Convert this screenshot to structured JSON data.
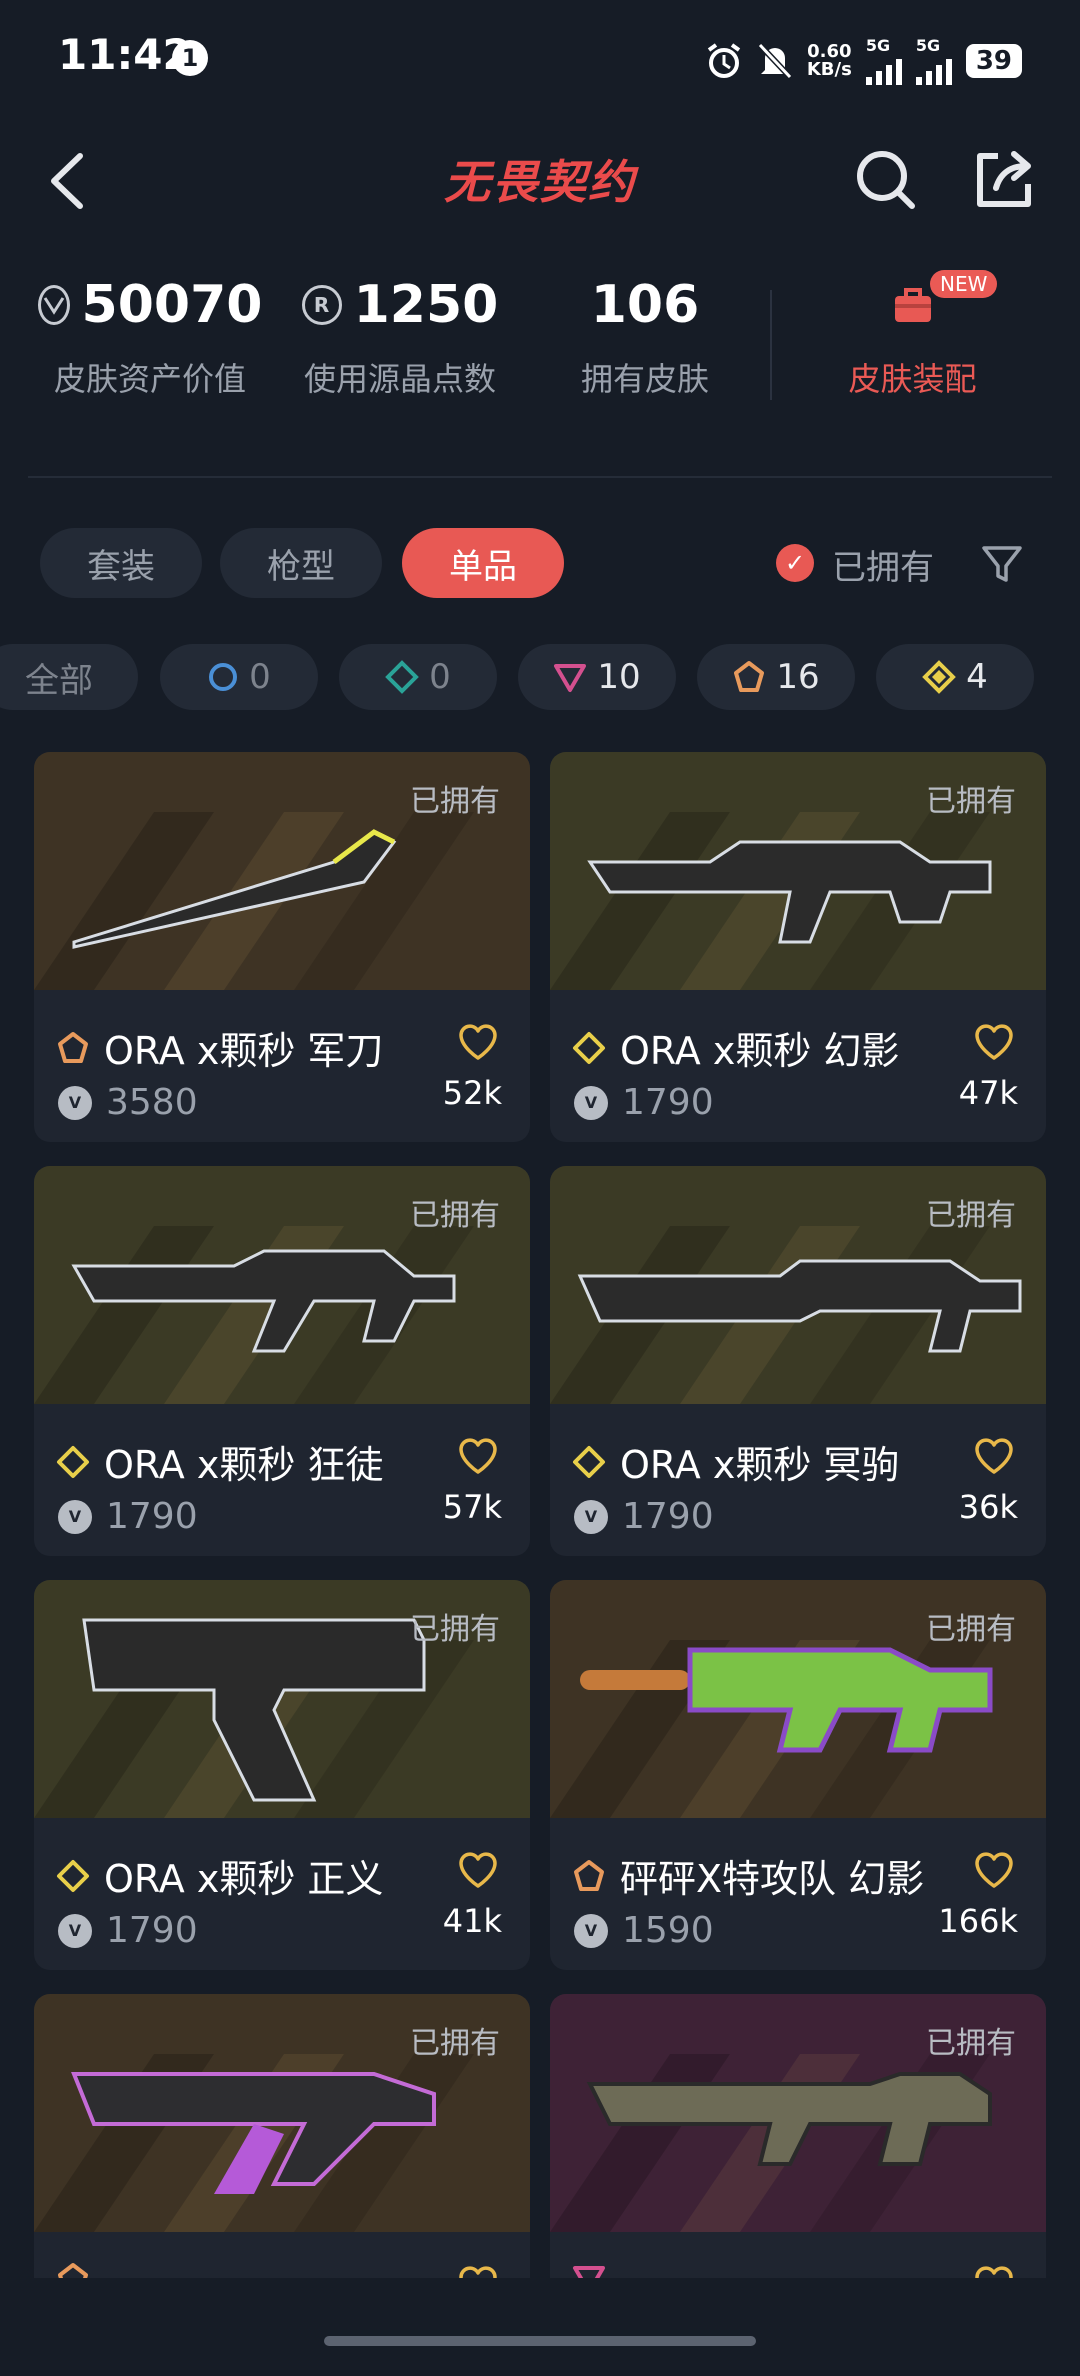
{
  "status_bar": {
    "time": "11:42",
    "notification_count": "1",
    "net_speed_value": "0.60",
    "net_speed_unit": "KB/s",
    "net_type_1": "5G",
    "net_type_2": "5G",
    "battery": "39"
  },
  "header": {
    "title": "无畏契约"
  },
  "stats": [
    {
      "value": "50070",
      "label": "皮肤资产价值",
      "icon": "vp-coin-icon"
    },
    {
      "value": "1250",
      "label": "使用源晶点数",
      "icon": "radianite-icon"
    },
    {
      "value": "106",
      "label": "拥有皮肤"
    },
    {
      "label": "皮肤装配",
      "badge": "NEW",
      "icon": "equip-bag-icon"
    }
  ],
  "filters": {
    "tabs": [
      "套装",
      "枪型",
      "单品"
    ],
    "active_tab": "单品",
    "owned_toggle_label": "已拥有",
    "owned_checked": true
  },
  "tiers": [
    {
      "label": "全部",
      "count": ""
    },
    {
      "icon": "select-tier-icon",
      "count": "0",
      "color": "#4a8fd6"
    },
    {
      "icon": "deluxe-tier-icon",
      "count": "0",
      "color": "#2aa398"
    },
    {
      "icon": "premium-tier-icon",
      "count": "10",
      "color": "#d4508f"
    },
    {
      "icon": "exclusive-tier-icon",
      "count": "16",
      "color": "#e89a5c"
    },
    {
      "icon": "ultra-tier-icon",
      "count": "4",
      "color": "#e8cf4a"
    }
  ],
  "cards": [
    {
      "name": "ORA x颗秒 军刀",
      "price": "3580",
      "likes": "52k",
      "owned_label": "已拥有",
      "tier_color": "#e89a5c",
      "bg": "#3e3324"
    },
    {
      "name": "ORA x颗秒 幻影",
      "price": "1790",
      "likes": "47k",
      "owned_label": "已拥有",
      "tier_color": "#e8cf4a",
      "bg": "#3b3a25"
    },
    {
      "name": "ORA x颗秒 狂徒",
      "price": "1790",
      "likes": "57k",
      "owned_label": "已拥有",
      "tier_color": "#e8cf4a",
      "bg": "#3b3a25"
    },
    {
      "name": "ORA x颗秒 冥驹",
      "price": "1790",
      "likes": "36k",
      "owned_label": "已拥有",
      "tier_color": "#e8cf4a",
      "bg": "#3b3a25"
    },
    {
      "name": "ORA x颗秒 正义",
      "price": "1790",
      "likes": "41k",
      "owned_label": "已拥有",
      "tier_color": "#e8cf4a",
      "bg": "#3b3a25"
    },
    {
      "name": "砰砰X特攻队 幻影",
      "price": "1590",
      "likes": "166k",
      "owned_label": "已拥有",
      "tier_color": "#e89a5c",
      "bg": "#3e3324"
    },
    {
      "name": "",
      "price": "",
      "likes": "",
      "owned_label": "已拥有",
      "tier_color": "#e89a5c",
      "bg": "#3e3324"
    },
    {
      "name": "",
      "price": "",
      "likes": "",
      "owned_label": "已拥有",
      "tier_color": "#d4508f",
      "bg": "#3e2236"
    }
  ]
}
